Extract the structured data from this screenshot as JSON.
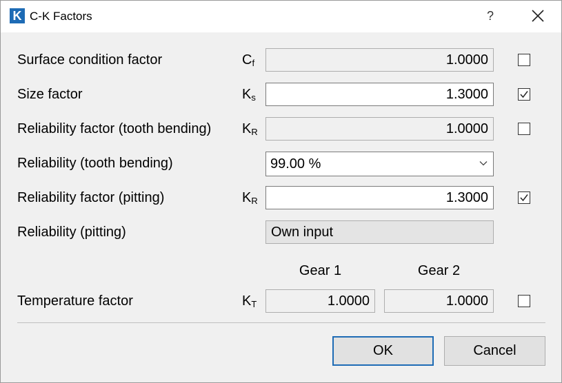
{
  "window": {
    "title": "C-K Factors",
    "app_icon_letter": "K",
    "help_glyph": "?"
  },
  "rows": [
    {
      "label": "Surface condition factor",
      "symbol": "C",
      "subscript": "f",
      "value": "1.0000",
      "checked": false
    },
    {
      "label": "Size factor",
      "symbol": "K",
      "subscript": "s",
      "value": "1.3000",
      "checked": true
    },
    {
      "label": "Reliability factor (tooth bending)",
      "symbol": "K",
      "subscript": "R",
      "value": "1.0000",
      "checked": false
    },
    {
      "label": "Reliability (tooth bending)",
      "value": "99.00 %"
    },
    {
      "label": "Reliability factor (pitting)",
      "symbol": "K",
      "subscript": "R",
      "value": "1.3000",
      "checked": true
    },
    {
      "label": "Reliability (pitting)",
      "value": "Own input"
    }
  ],
  "temperature": {
    "label": "Temperature factor",
    "symbol": "K",
    "subscript": "T",
    "gear1_header": "Gear 1",
    "gear2_header": "Gear 2",
    "gear1_value": "1.0000",
    "gear2_value": "1.0000",
    "checked": false
  },
  "buttons": {
    "ok": "OK",
    "cancel": "Cancel"
  },
  "colors": {
    "accent": "#1d6bb5",
    "dialog_bg": "#f0f0f0"
  }
}
